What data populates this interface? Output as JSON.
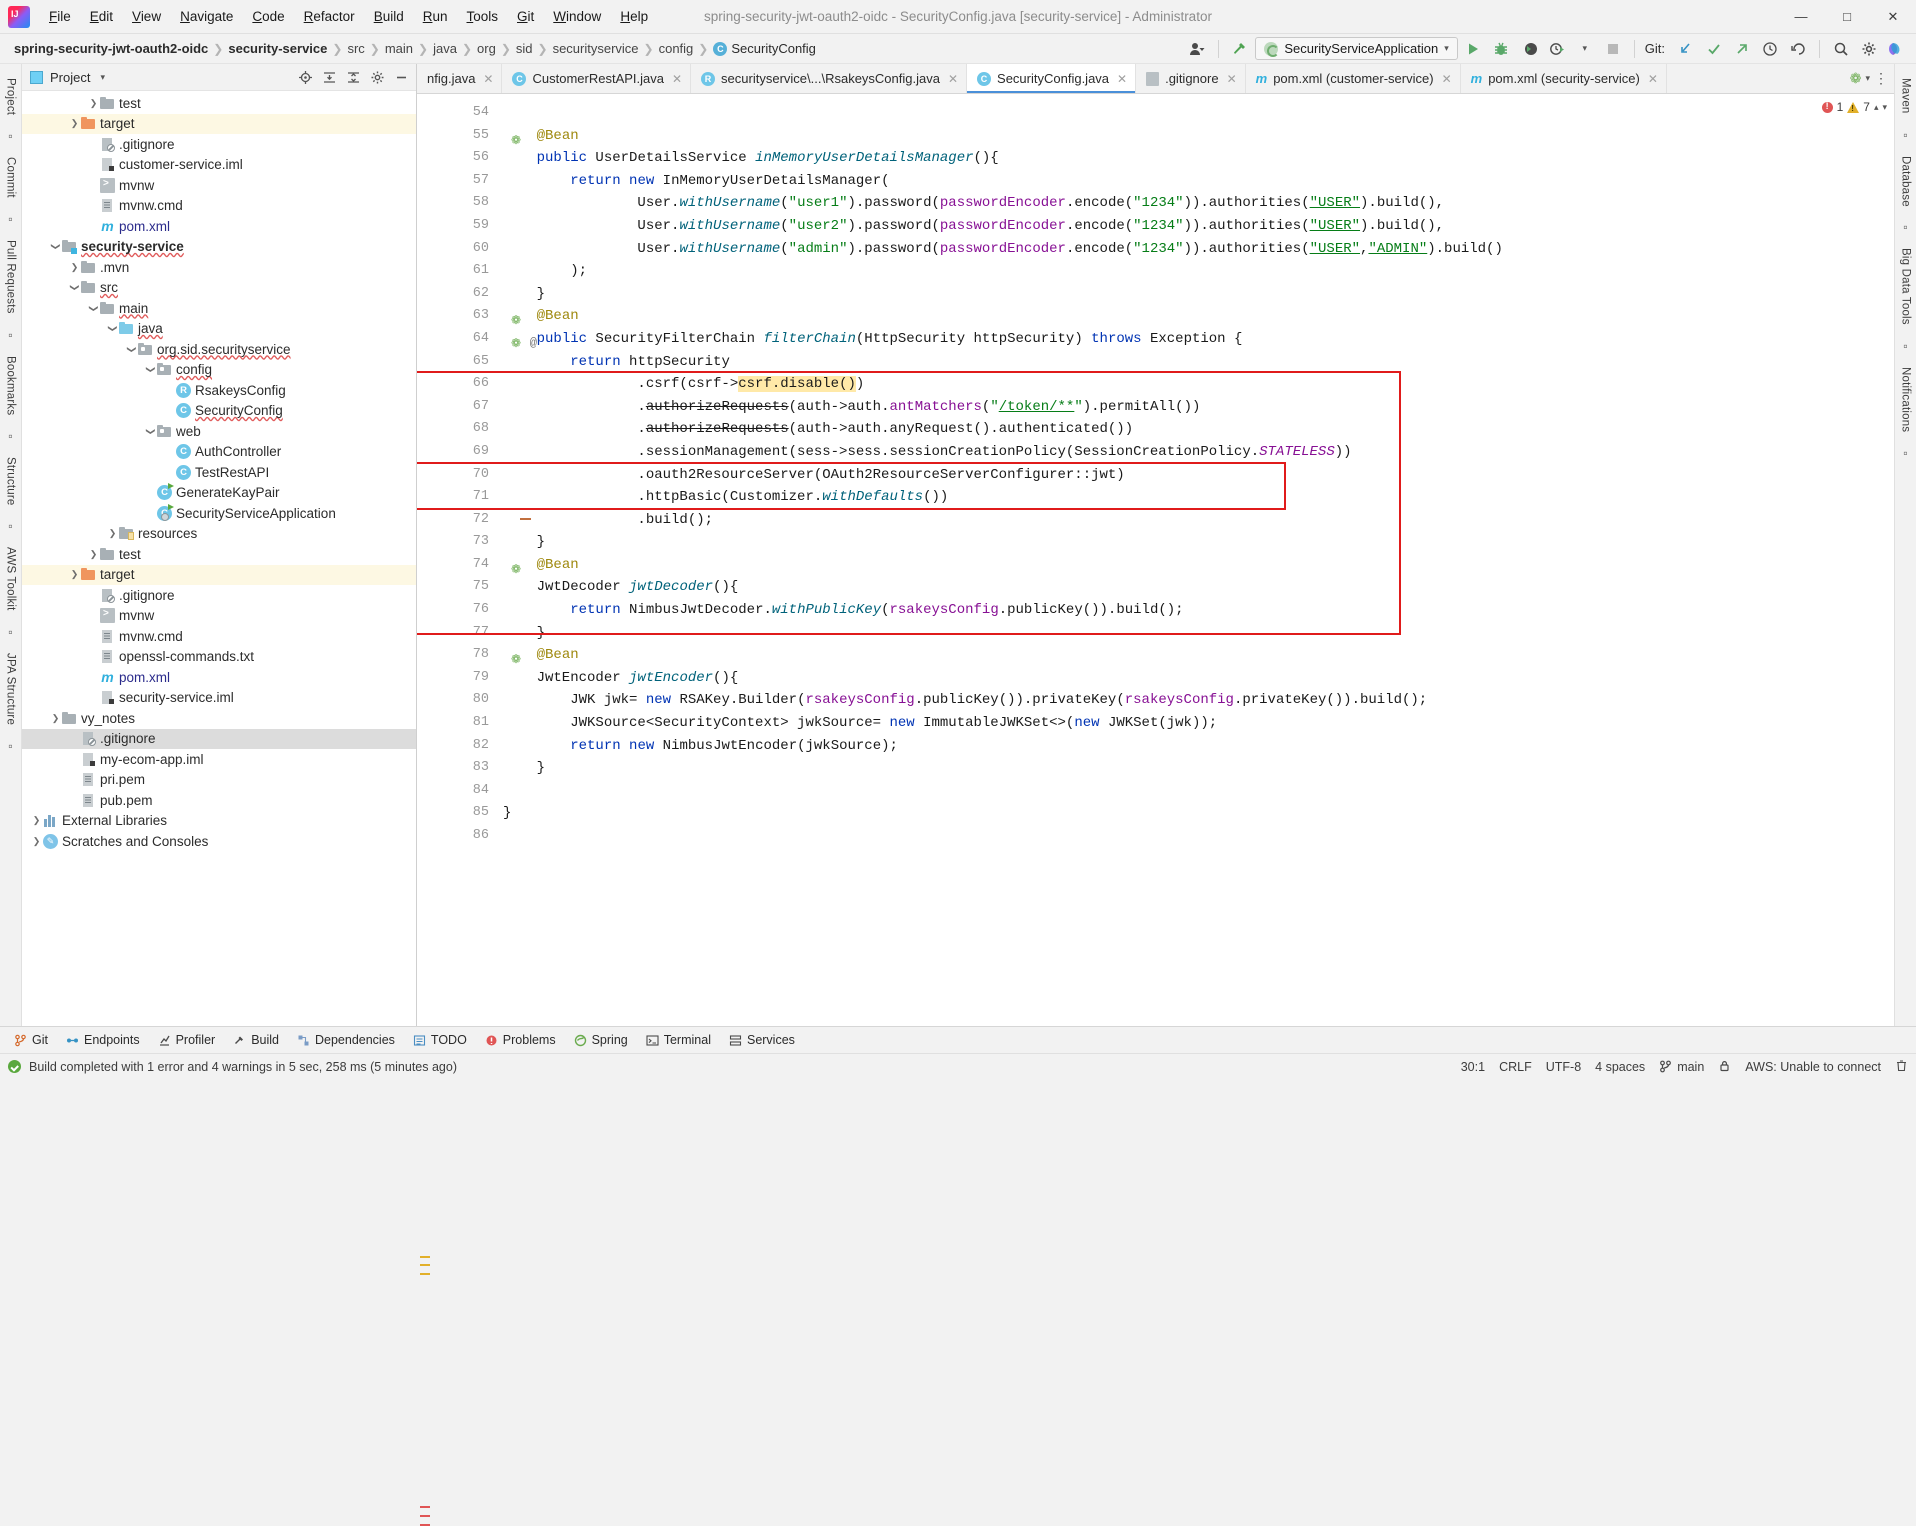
{
  "window": {
    "title": "spring-security-jwt-oauth2-oidc - SecurityConfig.java [security-service] - Administrator",
    "minimize": "—",
    "maximize": "□",
    "close": "✕"
  },
  "menu": [
    "File",
    "Edit",
    "View",
    "Navigate",
    "Code",
    "Refactor",
    "Build",
    "Run",
    "Tools",
    "Git",
    "Window",
    "Help"
  ],
  "breadcrumb": [
    {
      "label": "spring-security-jwt-oauth2-oidc",
      "style": "bold"
    },
    {
      "label": "security-service",
      "style": "bold"
    },
    {
      "label": "src",
      "style": "dim"
    },
    {
      "label": "main",
      "style": "dim"
    },
    {
      "label": "java",
      "style": "dim"
    },
    {
      "label": "org",
      "style": "dim"
    },
    {
      "label": "sid",
      "style": "dim"
    },
    {
      "label": "securityservice",
      "style": "dim"
    },
    {
      "label": "config",
      "style": "dim"
    },
    {
      "label": "SecurityConfig",
      "style": "class"
    }
  ],
  "toolbar": {
    "run_config": "SecurityServiceApplication",
    "git_label": "Git:",
    "icons": [
      "user-avatar-icon",
      "hammer-build-icon",
      "run-icon",
      "debug-icon",
      "run-coverage-icon",
      "profile-icon",
      "stop-icon",
      "git-update-icon",
      "git-commit-icon",
      "git-push-icon",
      "git-history-icon",
      "git-rollback-icon",
      "search-everywhere-icon",
      "settings-gear-icon",
      "ai-assistant-icon"
    ]
  },
  "project_panel": {
    "title": "Project",
    "header_icons": [
      "locate-icon",
      "expand-all-icon",
      "collapse-all-icon",
      "settings-icon",
      "hide-icon"
    ],
    "tree": [
      {
        "label": "test",
        "indent": 3,
        "arrow": "right",
        "icon": "folder",
        "state": "normal"
      },
      {
        "label": "target",
        "indent": 2,
        "arrow": "right",
        "icon": "folder-orange",
        "state": "highlight"
      },
      {
        "label": ".gitignore",
        "indent": 3,
        "arrow": "none",
        "icon": "file-git",
        "state": "normal"
      },
      {
        "label": "customer-service.iml",
        "indent": 3,
        "arrow": "none",
        "icon": "file-iml",
        "state": "normal"
      },
      {
        "label": "mvnw",
        "indent": 3,
        "arrow": "none",
        "icon": "sh",
        "state": "normal"
      },
      {
        "label": "mvnw.cmd",
        "indent": 3,
        "arrow": "none",
        "icon": "file",
        "state": "normal"
      },
      {
        "label": "pom.xml",
        "indent": 3,
        "arrow": "none",
        "icon": "maven",
        "state": "blue"
      },
      {
        "label": "security-service",
        "indent": 1,
        "arrow": "down",
        "icon": "folder-mod",
        "state": "bold-wavy"
      },
      {
        "label": ".mvn",
        "indent": 2,
        "arrow": "right",
        "icon": "folder",
        "state": "normal"
      },
      {
        "label": "src",
        "indent": 2,
        "arrow": "down",
        "icon": "folder",
        "state": "wavy"
      },
      {
        "label": "main",
        "indent": 3,
        "arrow": "down",
        "icon": "folder",
        "state": "wavy"
      },
      {
        "label": "java",
        "indent": 4,
        "arrow": "down",
        "icon": "folder-src",
        "state": "wavy"
      },
      {
        "label": "org.sid.securityservice",
        "indent": 5,
        "arrow": "down",
        "icon": "folder-pkg",
        "state": "wavy"
      },
      {
        "label": "config",
        "indent": 6,
        "arrow": "down",
        "icon": "folder-pkg",
        "state": "wavy"
      },
      {
        "label": "RsakeysConfig",
        "indent": 7,
        "arrow": "none",
        "icon": "cls-r",
        "state": "normal"
      },
      {
        "label": "SecurityConfig",
        "indent": 7,
        "arrow": "none",
        "icon": "cls-c",
        "state": "wavy"
      },
      {
        "label": "web",
        "indent": 6,
        "arrow": "down",
        "icon": "folder-pkg",
        "state": "normal"
      },
      {
        "label": "AuthController",
        "indent": 7,
        "arrow": "none",
        "icon": "cls-c",
        "state": "normal"
      },
      {
        "label": "TestRestAPI",
        "indent": 7,
        "arrow": "none",
        "icon": "cls-c",
        "state": "normal"
      },
      {
        "label": "GenerateKayPair",
        "indent": 6,
        "arrow": "none",
        "icon": "cls-run",
        "state": "normal"
      },
      {
        "label": "SecurityServiceApplication",
        "indent": 6,
        "arrow": "none",
        "icon": "cls-spring",
        "state": "normal"
      },
      {
        "label": "resources",
        "indent": 4,
        "arrow": "right",
        "icon": "folder-res",
        "state": "normal"
      },
      {
        "label": "test",
        "indent": 3,
        "arrow": "right",
        "icon": "folder",
        "state": "normal"
      },
      {
        "label": "target",
        "indent": 2,
        "arrow": "right",
        "icon": "folder-orange",
        "state": "highlight"
      },
      {
        "label": ".gitignore",
        "indent": 3,
        "arrow": "none",
        "icon": "file-git",
        "state": "normal"
      },
      {
        "label": "mvnw",
        "indent": 3,
        "arrow": "none",
        "icon": "sh",
        "state": "normal"
      },
      {
        "label": "mvnw.cmd",
        "indent": 3,
        "arrow": "none",
        "icon": "file",
        "state": "normal"
      },
      {
        "label": "openssl-commands.txt",
        "indent": 3,
        "arrow": "none",
        "icon": "file",
        "state": "normal"
      },
      {
        "label": "pom.xml",
        "indent": 3,
        "arrow": "none",
        "icon": "maven",
        "state": "blue"
      },
      {
        "label": "security-service.iml",
        "indent": 3,
        "arrow": "none",
        "icon": "file-iml",
        "state": "normal"
      },
      {
        "label": "vy_notes",
        "indent": 1,
        "arrow": "right",
        "icon": "folder",
        "state": "normal"
      },
      {
        "label": ".gitignore",
        "indent": 2,
        "arrow": "none",
        "icon": "file-git",
        "state": "selected"
      },
      {
        "label": "my-ecom-app.iml",
        "indent": 2,
        "arrow": "none",
        "icon": "file-iml",
        "state": "normal"
      },
      {
        "label": "pri.pem",
        "indent": 2,
        "arrow": "none",
        "icon": "file",
        "state": "normal"
      },
      {
        "label": "pub.pem",
        "indent": 2,
        "arrow": "none",
        "icon": "file",
        "state": "normal"
      },
      {
        "label": "External Libraries",
        "indent": 0,
        "arrow": "right",
        "icon": "libs",
        "state": "normal"
      },
      {
        "label": "Scratches and Consoles",
        "indent": 0,
        "arrow": "right",
        "icon": "scratch",
        "state": "normal"
      }
    ]
  },
  "left_rail": [
    "Project",
    "Commit",
    "Pull Requests",
    "Bookmarks",
    "Structure",
    "AWS Toolkit",
    "JPA Structure"
  ],
  "right_rail": [
    "Maven",
    "Database",
    "Big Data Tools",
    "Notifications"
  ],
  "editor_tabs": [
    {
      "label": "nfig.java",
      "icon": "java-class-icon",
      "active": false,
      "truncated": true
    },
    {
      "label": "CustomerRestAPI.java",
      "icon": "java-class-icon",
      "active": false
    },
    {
      "label": "securityservice\\...\\RsakeysConfig.java",
      "icon": "java-record-icon",
      "active": false
    },
    {
      "label": "SecurityConfig.java",
      "icon": "java-class-icon",
      "active": true
    },
    {
      "label": ".gitignore",
      "icon": "gitignore-icon",
      "active": false
    },
    {
      "label": "pom.xml (customer-service)",
      "icon": "maven-icon",
      "active": false
    },
    {
      "label": "pom.xml (security-service)",
      "icon": "maven-icon",
      "active": false
    }
  ],
  "inspection": {
    "errors": "1",
    "warnings": "7"
  },
  "code": {
    "first_line": 54,
    "lines": [
      {
        "n": 54,
        "html": ""
      },
      {
        "n": 55,
        "html": "    <span class='ann'>@Bean</span>",
        "bean": true
      },
      {
        "n": 56,
        "html": "    <span class='kw'>public</span> UserDetailsService <span class='mth ital'>inMemoryUserDetailsManager</span>(){"
      },
      {
        "n": 57,
        "html": "        <span class='kw'>return</span> <span class='kw'>new</span> InMemoryUserDetailsManager("
      },
      {
        "n": 58,
        "html": "                User.<span class='mth ital'>withUsername</span>(<span class='str'>\"user1\"</span>).password(<span class='fld'>passwordEncoder</span>.encode(<span class='str'>\"1234\"</span>)).authorities(<span class='str url'>\"USER\"</span>).build(),"
      },
      {
        "n": 59,
        "html": "                User.<span class='mth ital'>withUsername</span>(<span class='str'>\"user2\"</span>).password(<span class='fld'>passwordEncoder</span>.encode(<span class='str'>\"1234\"</span>)).authorities(<span class='str url'>\"USER\"</span>).build(),"
      },
      {
        "n": 60,
        "html": "                User.<span class='mth ital'>withUsername</span>(<span class='str'>\"admin\"</span>).password(<span class='fld'>passwordEncoder</span>.encode(<span class='str'>\"1234\"</span>)).authorities(<span class='str url'>\"USER\"</span>,<span class='str url'>\"ADMIN\"</span>).build()"
      },
      {
        "n": 61,
        "html": "        );"
      },
      {
        "n": 62,
        "html": "    }"
      },
      {
        "n": 63,
        "html": "    <span class='ann'>@Bean</span>",
        "bean": true
      },
      {
        "n": 64,
        "html": "    <span class='kw'>public</span> SecurityFilterChain <span class='mth ital'>filterChain</span>(HttpSecurity httpSecurity) <span class='kw'>throws</span> Exception {",
        "bean": true,
        "at": true
      },
      {
        "n": 65,
        "html": "        <span class='kw'>return</span> httpSecurity"
      },
      {
        "n": 66,
        "html": "                .csrf(csrf-&gt;<span class='hlstr'>csrf.disable()</span>)"
      },
      {
        "n": 67,
        "html": "                .<span style='text-decoration:line-through'>authorizeRequests</span>(auth-&gt;auth.<span class='fld'>antMatchers</span>(<span class='str'>\"<span class='url'>/token/**</span>\"</span>).permitAll())"
      },
      {
        "n": 68,
        "html": "                .<span style='text-decoration:line-through'>authorizeRequests</span>(auth-&gt;auth.anyRequest().authenticated())"
      },
      {
        "n": 69,
        "html": "                .sessionManagement(sess-&gt;sess.sessionCreationPolicy(SessionCreationPolicy.<span class='stat ital'>STATELESS</span>))"
      },
      {
        "n": 70,
        "html": "                .oauth2ResourceServer(OAuth2ResourceServerConfigurer::jwt)"
      },
      {
        "n": 71,
        "html": "                .httpBasic(Customizer.<span class='mth ital'>withDefaults</span>())"
      },
      {
        "n": 72,
        "html": "                .build();",
        "fold": true
      },
      {
        "n": 73,
        "html": "    }"
      },
      {
        "n": 74,
        "html": "    <span class='ann'>@Bean</span>",
        "bean": true
      },
      {
        "n": 75,
        "html": "    JwtDecoder <span class='mth ital'>jwtDecoder</span>(){"
      },
      {
        "n": 76,
        "html": "        <span class='kw'>return</span> NimbusJwtDecoder.<span class='mth ital'>withPublicKey</span>(<span class='fld'>rsakeysConfig</span>.publicKey()).build();"
      },
      {
        "n": 77,
        "html": "    }"
      },
      {
        "n": 78,
        "html": "    <span class='ann'>@Bean</span>",
        "bean": true
      },
      {
        "n": 79,
        "html": "    JwtEncoder <span class='mth ital'>jwtEncoder</span>(){"
      },
      {
        "n": 80,
        "html": "        JWK jwk= <span class='kw'>new</span> RSAKey.Builder(<span class='fld'>rsakeysConfig</span>.publicKey()).privateKey(<span class='fld'>rsakeysConfig</span>.privateKey()).build();"
      },
      {
        "n": 81,
        "html": "        JWKSource&lt;SecurityContext&gt; jwkSource= <span class='kw'>new</span> ImmutableJWKSet&lt;&gt;(<span class='kw'>new</span> JWKSet(jwk));"
      },
      {
        "n": 82,
        "html": "        <span class='kw'>return</span> <span class='kw'>new</span> NimbusJwtEncoder(jwkSource);"
      },
      {
        "n": 83,
        "html": "    }"
      },
      {
        "n": 84,
        "html": ""
      },
      {
        "n": 85,
        "html": "}"
      },
      {
        "n": 86,
        "html": ""
      }
    ]
  },
  "bottom_tools": [
    {
      "label": "Git",
      "icon": "git-icon"
    },
    {
      "label": "Endpoints",
      "icon": "endpoints-icon"
    },
    {
      "label": "Profiler",
      "icon": "profiler-icon"
    },
    {
      "label": "Build",
      "icon": "build-hammer-icon"
    },
    {
      "label": "Dependencies",
      "icon": "dependencies-icon"
    },
    {
      "label": "TODO",
      "icon": "todo-icon"
    },
    {
      "label": "Problems",
      "icon": "problems-icon"
    },
    {
      "label": "Spring",
      "icon": "spring-icon"
    },
    {
      "label": "Terminal",
      "icon": "terminal-icon"
    },
    {
      "label": "Services",
      "icon": "services-icon"
    }
  ],
  "status_bar": {
    "message": "Build completed with 1 error and 4 warnings in 5 sec, 258 ms (5 minutes ago)",
    "caret": "30:1",
    "line_sep": "CRLF",
    "encoding": "UTF-8",
    "indent": "4 spaces",
    "branch": "main",
    "aws": "AWS: Unable to connect"
  }
}
